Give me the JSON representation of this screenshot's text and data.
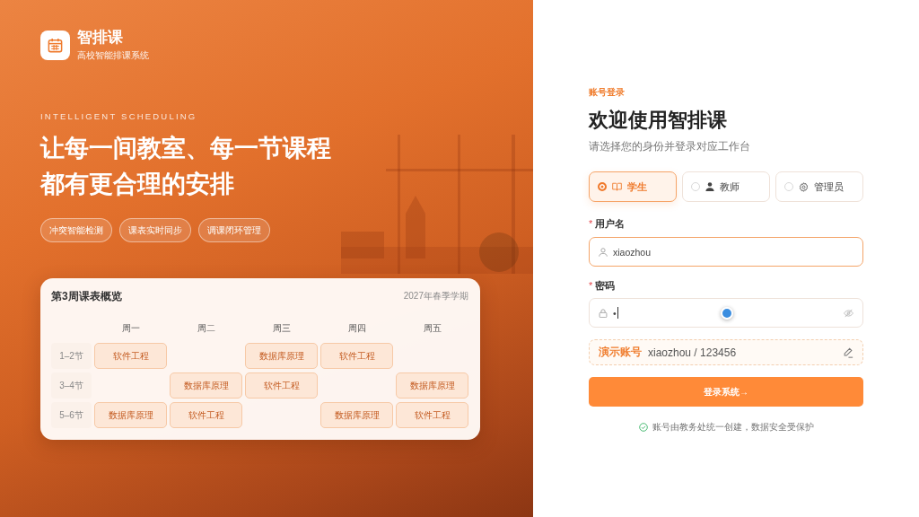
{
  "brand": {
    "name": "智排课",
    "subtitle": "高校智能排课系统"
  },
  "hero": {
    "eyebrow": "INTELLIGENT SCHEDULING",
    "headline": [
      "让每一间教室、每一节课程",
      "都有更合理的安排"
    ],
    "features": [
      "冲突智能检测",
      "课表实时同步",
      "调课闭环管理"
    ]
  },
  "schedule_card": {
    "title": "第3周课表概览",
    "term": "2027年春季学期",
    "days": [
      "周一",
      "周二",
      "周三",
      "周四",
      "周五"
    ],
    "rows": [
      {
        "period": "1–2节",
        "cells": [
          "软件工程",
          null,
          "数据库原理",
          "软件工程",
          null
        ]
      },
      {
        "period": "3–4节",
        "cells": [
          null,
          "数据库原理",
          "软件工程",
          null,
          "数据库原理"
        ]
      },
      {
        "period": "5–6节",
        "cells": [
          "数据库原理",
          "软件工程",
          null,
          "数据库原理",
          "软件工程"
        ]
      }
    ]
  },
  "login": {
    "eyebrow": "账号登录",
    "title": "欢迎使用智排课",
    "subtitle": "请选择您的身份并登录对应工作台",
    "roles": [
      {
        "kind": "student",
        "label": "学生",
        "selected": true
      },
      {
        "kind": "teacher",
        "label": "教师",
        "selected": false
      },
      {
        "kind": "admin",
        "label": "管理员",
        "selected": false
      }
    ],
    "fields": [
      {
        "kind": "username",
        "required_mark": "*",
        "label": "用户名",
        "value": "xiaozhou",
        "highlighted": true,
        "focused": false
      },
      {
        "kind": "password",
        "required_mark": "*",
        "label": "密码",
        "value": "•",
        "highlighted": false,
        "focused": true
      }
    ],
    "demo": {
      "label": "演示账号",
      "value": "xiaozhou / 123456"
    },
    "submit": "登录系统→",
    "note": "账号由教务处统一创建，数据安全受保护"
  }
}
